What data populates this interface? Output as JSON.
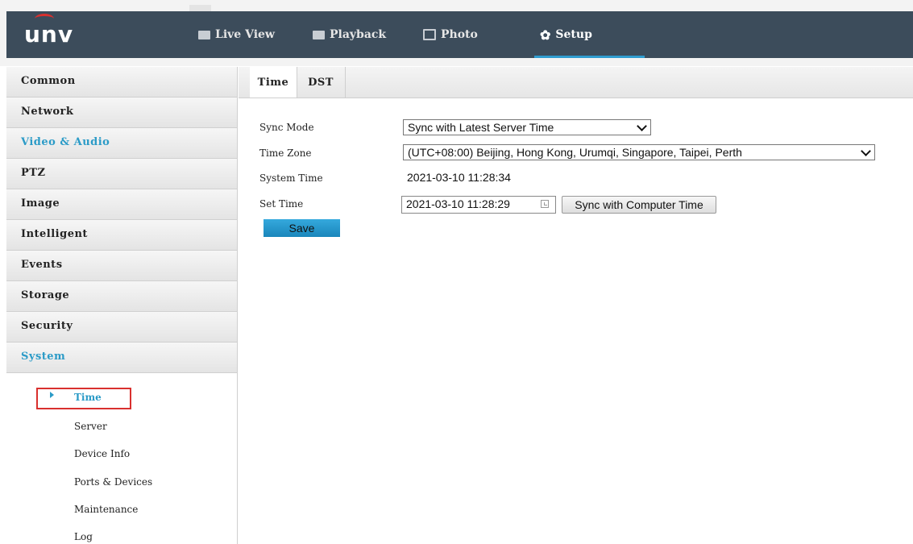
{
  "header": {
    "logo": "unv",
    "nav": [
      {
        "label": "Live View",
        "icon": "monitor-icon"
      },
      {
        "label": "Playback",
        "icon": "playback-icon"
      },
      {
        "label": "Photo",
        "icon": "photo-icon"
      },
      {
        "label": "Setup",
        "icon": "gear-icon"
      }
    ],
    "active_nav": "Setup"
  },
  "sidebar": {
    "items": [
      {
        "label": "Common"
      },
      {
        "label": "Network"
      },
      {
        "label": "Video & Audio"
      },
      {
        "label": "PTZ"
      },
      {
        "label": "Image"
      },
      {
        "label": "Intelligent"
      },
      {
        "label": "Events"
      },
      {
        "label": "Storage"
      },
      {
        "label": "Security"
      },
      {
        "label": "System"
      }
    ],
    "sub_items": [
      {
        "label": "Time"
      },
      {
        "label": "Server"
      },
      {
        "label": "Device Info"
      },
      {
        "label": "Ports & Devices"
      },
      {
        "label": "Maintenance"
      },
      {
        "label": "Log"
      }
    ],
    "selected_sub": "Time"
  },
  "content": {
    "tabs": [
      {
        "label": "Time"
      },
      {
        "label": "DST"
      }
    ],
    "fields": {
      "sync_mode_label": "Sync Mode",
      "sync_mode_value": "Sync with Latest Server Time",
      "time_zone_label": "Time Zone",
      "time_zone_value": "(UTC+08:00) Beijing, Hong Kong, Urumqi, Singapore, Taipei, Perth",
      "system_time_label": "System Time",
      "system_time_value": "2021-03-10 11:28:34",
      "set_time_label": "Set Time",
      "set_time_value": "2021-03-10 11:28:29"
    },
    "sync_computer_button": "Sync with Computer Time",
    "save_button": "Save"
  },
  "colors": {
    "header_bg": "#3c4c5b",
    "accent": "#2b9bc7",
    "selection_border": "#d9302e",
    "save_button": "#1f93c9"
  }
}
